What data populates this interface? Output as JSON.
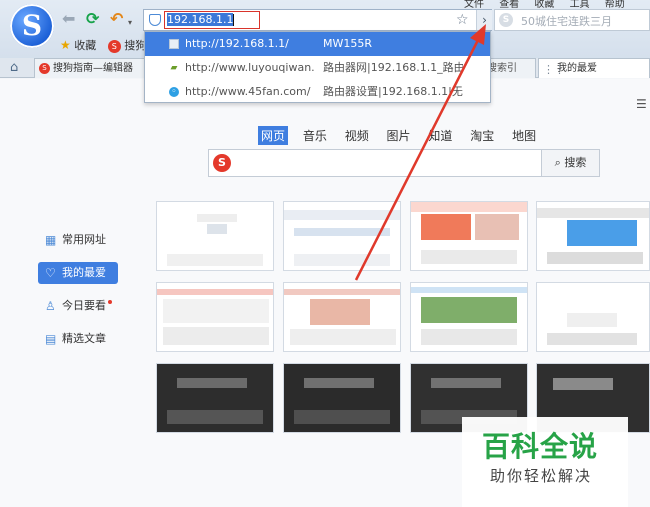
{
  "browser": {
    "logo_letter": "S",
    "menu": [
      "文件",
      "查看",
      "收藏",
      "工具",
      "帮助"
    ],
    "address": {
      "typed": "192.168.1.1"
    },
    "search": {
      "placeholder": "50城住宅连跌三月"
    },
    "favorites": {
      "label": "收藏",
      "item": "搜狗 "
    },
    "undo_dropdown": "▾",
    "go_arrow": "›"
  },
  "tabs": [
    {
      "label": "搜狗指南—编辑器"
    },
    {
      "label": "搜索引"
    },
    {
      "label": "我的最爱"
    }
  ],
  "suggestions": [
    {
      "url": "http://192.168.1.1/",
      "title": "MW155R",
      "active": true
    },
    {
      "url": "http://www.luyouqiwan...",
      "title": "路由器网|192.168.1.1_路由...",
      "active": false
    },
    {
      "url": "http://www.45fan.com/",
      "title": "路由器设置|192.168.1.1|无...",
      "active": false
    }
  ],
  "search_tabs": [
    "网页",
    "音乐",
    "视频",
    "图片",
    "知道",
    "淘宝",
    "地图"
  ],
  "search_button": "搜索",
  "left_nav": [
    {
      "label": "常用网址",
      "icon": "grid-icon",
      "glyph": "▦"
    },
    {
      "label": "我的最爱",
      "icon": "heart-icon",
      "glyph": "♡",
      "active": true
    },
    {
      "label": "今日要看",
      "icon": "user-icon",
      "glyph": "♙",
      "dot": true
    },
    {
      "label": "精选文章",
      "icon": "document-icon",
      "glyph": "▤"
    }
  ],
  "watermark": {
    "title": "百科全说",
    "subtitle": "助你轻松解决"
  },
  "colors": {
    "accent": "#3f7ee0",
    "arrow": "#e0392b",
    "watermark_green": "#27a347"
  }
}
